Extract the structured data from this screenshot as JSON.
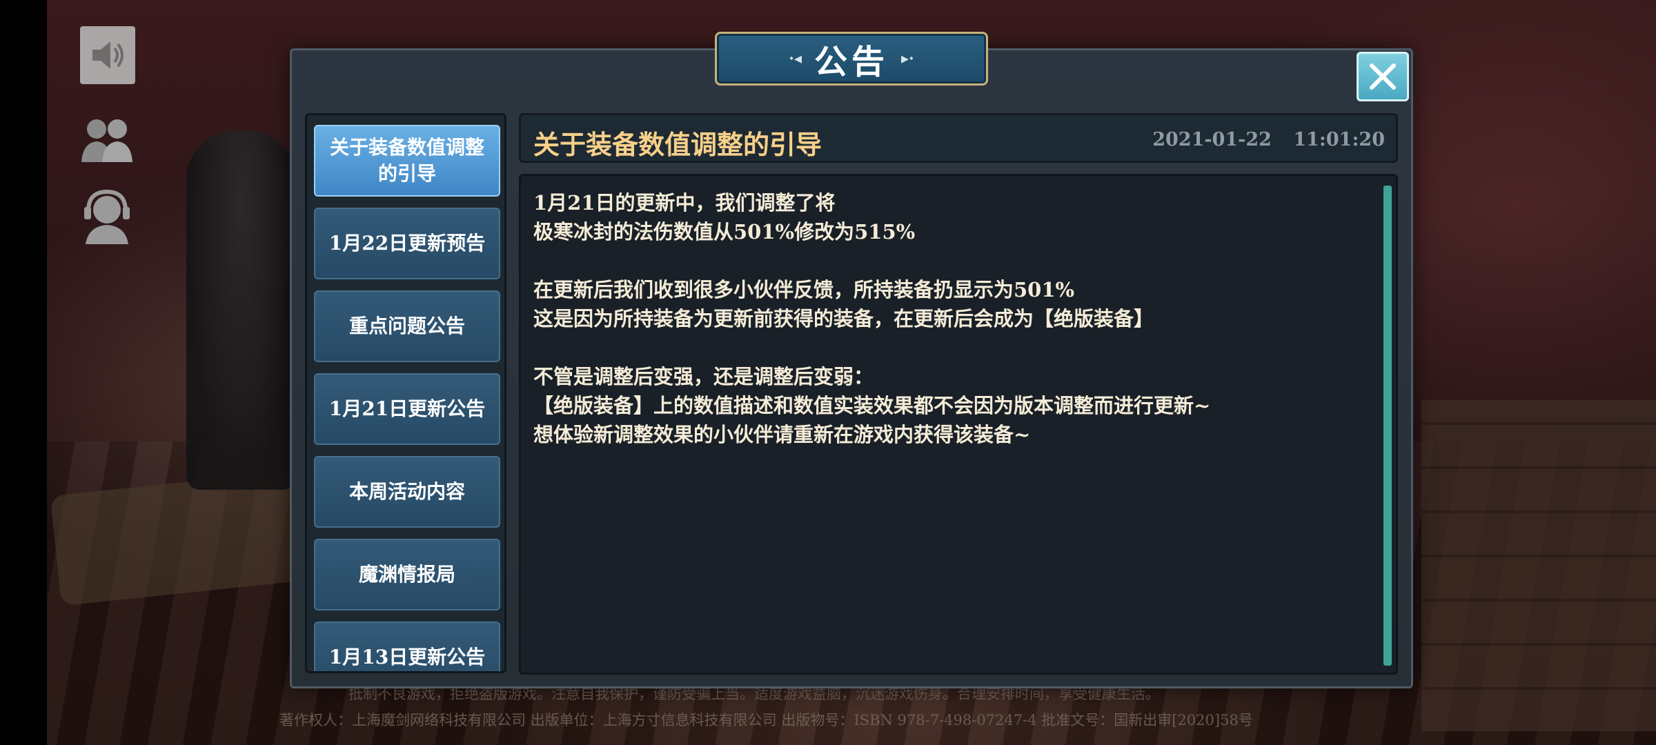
{
  "dialog": {
    "title": "公告",
    "title_ornament_left": "·◂",
    "title_ornament_right": "▸·"
  },
  "tabs": [
    {
      "label": "关于装备数值调整的引导",
      "active": true
    },
    {
      "label": "1月22日更新预告",
      "active": false
    },
    {
      "label": "重点问题公告",
      "active": false
    },
    {
      "label": "1月21日更新公告",
      "active": false
    },
    {
      "label": "本周活动内容",
      "active": false
    },
    {
      "label": "魔渊情报局",
      "active": false
    },
    {
      "label": "1月13日更新公告",
      "active": false
    }
  ],
  "article": {
    "title": "关于装备数值调整的引导",
    "date": "2021-01-22 11:01:20",
    "lines": [
      "1月21日的更新中，我们调整了将",
      "极寒冰封的法伤数值从501%修改为515%",
      "",
      "在更新后我们收到很多小伙伴反馈，所持装备扔显示为501%",
      "这是因为所持装备为更新前获得的装备，在更新后会成为【绝版装备】",
      "",
      "不管是调整后变强，还是调整后变弱：",
      "【绝版装备】上的数值描述和数值实装效果都不会因为版本调整而进行更新~",
      "想体验新调整效果的小伙伴请重新在游戏内获得该装备~"
    ]
  },
  "footer": {
    "line1": "抵制不良游戏，拒绝盗版游戏。注意自我保护，谨防受骗上当。适度游戏益脑，沉迷游戏伤身。合理安排时间，享受健康生活。",
    "line2": "著作权人：上海魔剑网络科技有限公司   出版单位：上海方寸信息科技有限公司   出版物号：ISBN 978-7-498-07247-4   批准文号：国新出审[2020]58号"
  },
  "hud": {
    "icons": [
      "speaker-icon",
      "friends-icon",
      "support-headset-icon"
    ]
  },
  "colors": {
    "title_plate": "#1d4a68",
    "active_tab": "#3f86c6",
    "article_title": "#f7d08a",
    "body_text": "#f4ecd8",
    "scrollbar": "#3fa39a"
  }
}
